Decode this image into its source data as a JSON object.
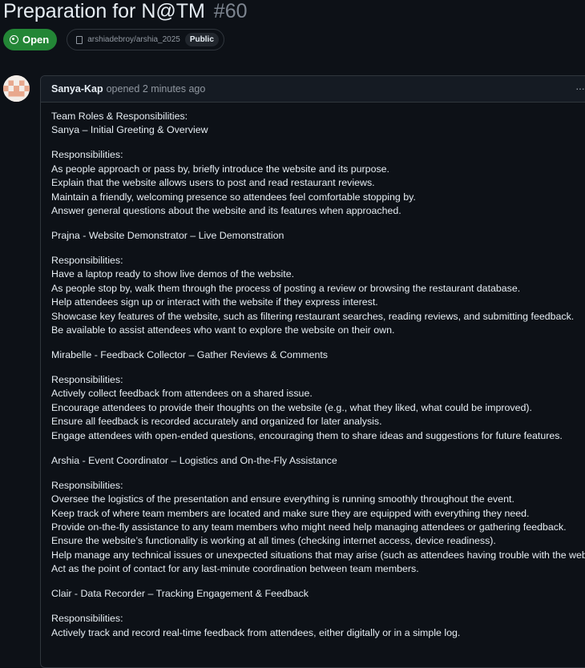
{
  "issue": {
    "title": "Preparation for N@TM",
    "number": "#60",
    "state": "Open",
    "repo": "arshiadebroy/arshia_2025",
    "visibility": "Public"
  },
  "comment": {
    "author": "Sanya-Kap",
    "action": "opened",
    "time": "2 minutes ago",
    "menu_icon": "kebab-horizontal-icon",
    "paragraphs": [
      [
        "Team Roles & Responsibilities:",
        "Sanya – Initial Greeting & Overview"
      ],
      [
        "Responsibilities:",
        "As people approach or pass by, briefly introduce the website and its purpose.",
        "Explain that the website allows users to post and read restaurant reviews.",
        "Maintain a friendly, welcoming presence so attendees feel comfortable stopping by.",
        "Answer general questions about the website and its features when approached."
      ],
      [
        "Prajna - Website Demonstrator – Live Demonstration"
      ],
      [
        "Responsibilities:",
        "Have a laptop ready to show live demos of the website.",
        "As people stop by, walk them through the process of posting a review or browsing the restaurant database.",
        "Help attendees sign up or interact with the website if they express interest.",
        "Showcase key features of the website, such as filtering restaurant searches, reading reviews, and submitting feedback.",
        "Be available to assist attendees who want to explore the website on their own."
      ],
      [
        "Mirabelle - Feedback Collector – Gather Reviews & Comments"
      ],
      [
        "Responsibilities:",
        "Actively collect feedback from attendees on a shared issue.",
        "Encourage attendees to provide their thoughts on the website (e.g., what they liked, what could be improved).",
        "Ensure all feedback is recorded accurately and organized for later analysis.",
        "Engage attendees with open-ended questions, encouraging them to share ideas and suggestions for future features."
      ],
      [
        "Arshia - Event Coordinator – Logistics and On-the-Fly Assistance"
      ],
      [
        "Responsibilities:",
        "Oversee the logistics of the presentation and ensure everything is running smoothly throughout the event.",
        "Keep track of where team members are located and make sure they are equipped with everything they need.",
        "Provide on-the-fly assistance to any team members who might need help managing attendees or gathering feedback.",
        "Ensure the website’s functionality is working at all times (checking internet access, device readiness).",
        "Help manage any technical issues or unexpected situations that may arise (such as attendees having trouble with the website).",
        "Act as the point of contact for any last-minute coordination between team members."
      ],
      [
        "Clair - Data Recorder – Tracking Engagement & Feedback"
      ],
      [
        "Responsibilities:",
        "Actively track and record real-time feedback from attendees, either digitally or in a simple log."
      ]
    ]
  },
  "colors": {
    "background": "#0d1117",
    "open_badge": "#238636",
    "border": "#30363d",
    "muted_text": "#9198a1"
  }
}
